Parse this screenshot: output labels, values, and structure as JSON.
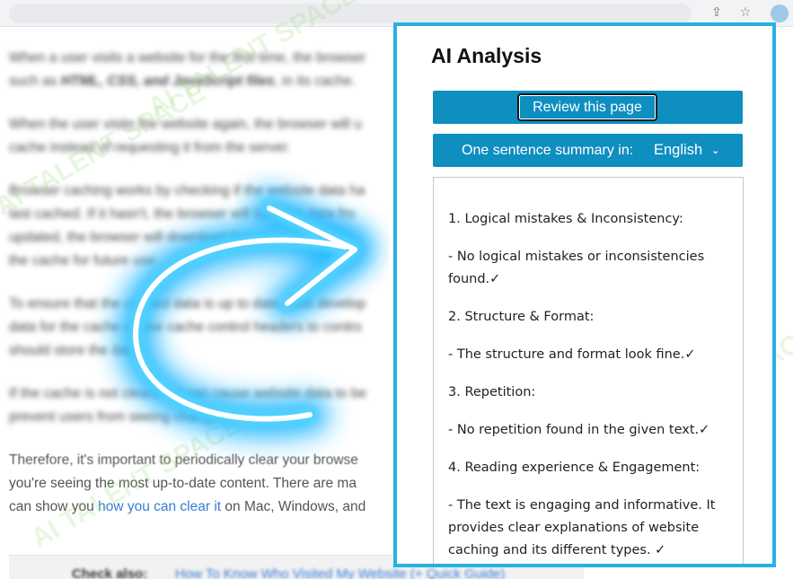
{
  "browser": {
    "share_icon": "share-icon",
    "star_icon": "star-icon",
    "extension_icon": "extension-icon"
  },
  "article": {
    "p1a": "When a user visits a website for the first time, the browser",
    "p1b": "such as ",
    "p1b_em": "HTML, CSS, and JavaScript files",
    "p1b_end": ", in its cache.",
    "p2a": "When the user visits the website again, the browser will u",
    "p2b": "cache instead of requesting it from the server.",
    "p3a": "Browser caching works by checking if the website data ha",
    "p3b": "last cached. If it hasn't, the browser will load the data fro",
    "p3c": "updated, the browser will download the new data from",
    "p3d": "the cache for future use.",
    "p4a": "To ensure that the cached data is up to date, web develop",
    "p4b": "data for the cache or use cache control headers to contro",
    "p4c": "should store the data.",
    "p5a": "If the cache is not cleared, it can cause website data to be",
    "p5b": "prevent users from seeing changes.",
    "p6a": "Therefore, it's important to periodically clear your browse",
    "p6b": "you're seeing the most up-to-date content. There are ma",
    "p6c_start": "can show you ",
    "p6c_link": "how you can clear it",
    "p6c_end": " on Mac, Windows, and",
    "card_check": "Check also:",
    "card_link": "How To Know Who Visited My Website (+ Quick Guide)"
  },
  "watermark": "AI TALENT SPACE",
  "panel": {
    "title": "AI Analysis",
    "review_button": "Review this page",
    "summary_label": "One sentence summary in:",
    "language": "English",
    "chevron_icon": "chevron-down-icon",
    "results": [
      "1. Logical mistakes & Inconsistency:",
      "- No logical mistakes or inconsistencies found.✓",
      "2. Structure & Format:",
      "- The structure and format look fine.✓",
      "3. Repetition:",
      "- No repetition found in the given text.✓",
      "4. Reading experience & Engagement:",
      "- The text is engaging and informative. It provides clear explanations of website caching and its different types. ✓"
    ]
  },
  "colors": {
    "panel_border": "#26b1e3",
    "button_blue": "#0f8ec0",
    "arrow_glow": "#1fb6ff"
  }
}
